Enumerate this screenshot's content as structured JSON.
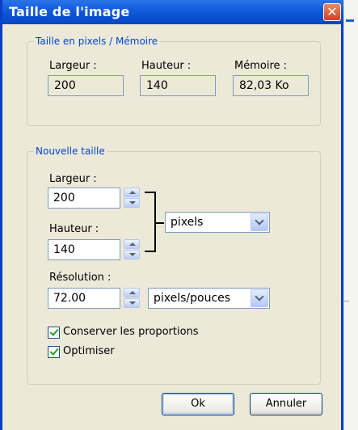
{
  "window": {
    "title": "Taille de l'image",
    "close_glyph": "✕"
  },
  "pixel_group": {
    "legend": "Taille en pixels / Mémoire",
    "width_label": "Largeur :",
    "width_value": "200",
    "height_label": "Hauteur :",
    "height_value": "140",
    "memory_label": "Mémoire :",
    "memory_value": "82,03 Ko"
  },
  "new_size_group": {
    "legend": "Nouvelle taille",
    "width_label": "Largeur :",
    "width_value": "200",
    "height_label": "Hauteur :",
    "height_value": "140",
    "unit_selected": "pixels",
    "resolution_label": "Résolution :",
    "resolution_value": "72.00",
    "resolution_unit_selected": "pixels/pouces",
    "keep_proportions_label": "Conserver les proportions",
    "keep_proportions_checked": true,
    "optimize_label": "Optimiser",
    "optimize_checked": true
  },
  "buttons": {
    "ok_label": "Ok",
    "cancel_label": "Annuler"
  },
  "colors": {
    "title_bar": "#0a55d8",
    "dialog_bg": "#ece9d8",
    "legend_text": "#0046d5",
    "close_button": "#d3421d"
  },
  "icons": {
    "close": "close-icon",
    "spin": "spinner-arrows-icon",
    "dropdown": "chevron-down-icon",
    "check": "checkmark-icon"
  }
}
